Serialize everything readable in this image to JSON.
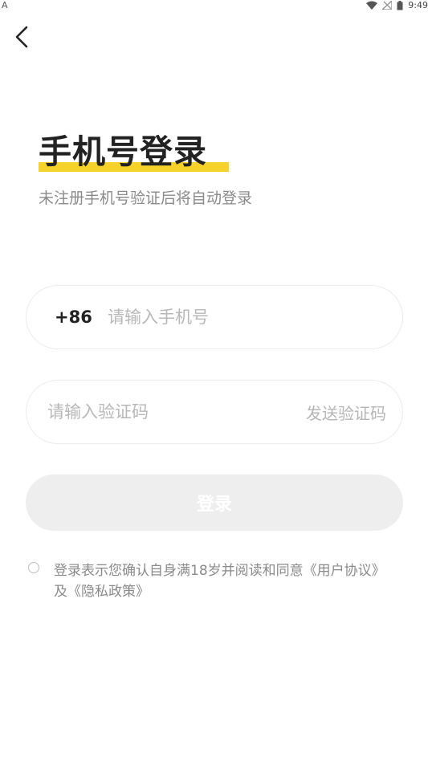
{
  "status_bar": {
    "left_indicator": "A",
    "time": "9:49",
    "icons": [
      "wifi-icon",
      "no-signal-icon",
      "battery-icon"
    ]
  },
  "header": {
    "back_icon": "chevron-left-icon"
  },
  "page": {
    "title": "手机号登录",
    "subtitle": "未注册手机号验证后将自动登录",
    "highlight_color": "#f6d22a"
  },
  "phone": {
    "country_code": "+86",
    "placeholder": "请输入手机号",
    "value": ""
  },
  "code": {
    "placeholder": "请输入验证码",
    "value": "",
    "send_label": "发送验证码"
  },
  "login": {
    "label": "登录",
    "bg_color": "#eeeeee"
  },
  "agreement": {
    "checked": false,
    "text_prefix": "登录表示您确认自身满18岁并阅读和同意",
    "user_agreement": "《用户协议》",
    "conjunction": "及",
    "privacy_policy": "《隐私政策》"
  }
}
